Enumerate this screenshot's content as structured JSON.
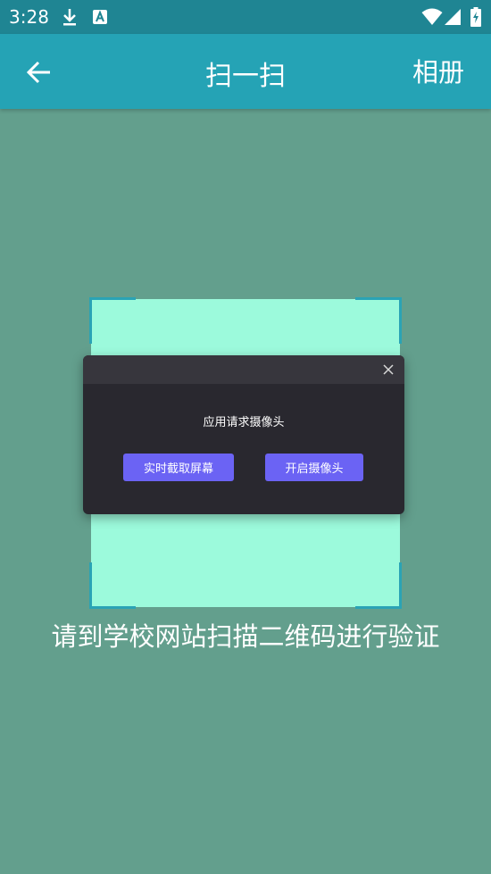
{
  "status_bar": {
    "time": "3:28",
    "icons": [
      "download-icon",
      "font-a-icon",
      "wifi-icon",
      "signal-icon",
      "battery-charging-icon"
    ]
  },
  "toolbar": {
    "back_icon": "arrow-left-icon",
    "title": "扫一扫",
    "album_label": "相册"
  },
  "scanner": {
    "hint": "请到学校网站扫描二维码进行验证"
  },
  "dialog": {
    "message": "应用请求摄像头",
    "close_icon": "close-icon",
    "buttons": {
      "screen_capture": "实时截取屏幕",
      "open_camera": "开启摄像头"
    }
  },
  "colors": {
    "status_bar": "#1f8593",
    "toolbar": "#25a3b5",
    "background": "#639f8d",
    "scan_area": "#9cfadc",
    "dialog_bg": "#29282f",
    "button": "#6b63f4"
  }
}
